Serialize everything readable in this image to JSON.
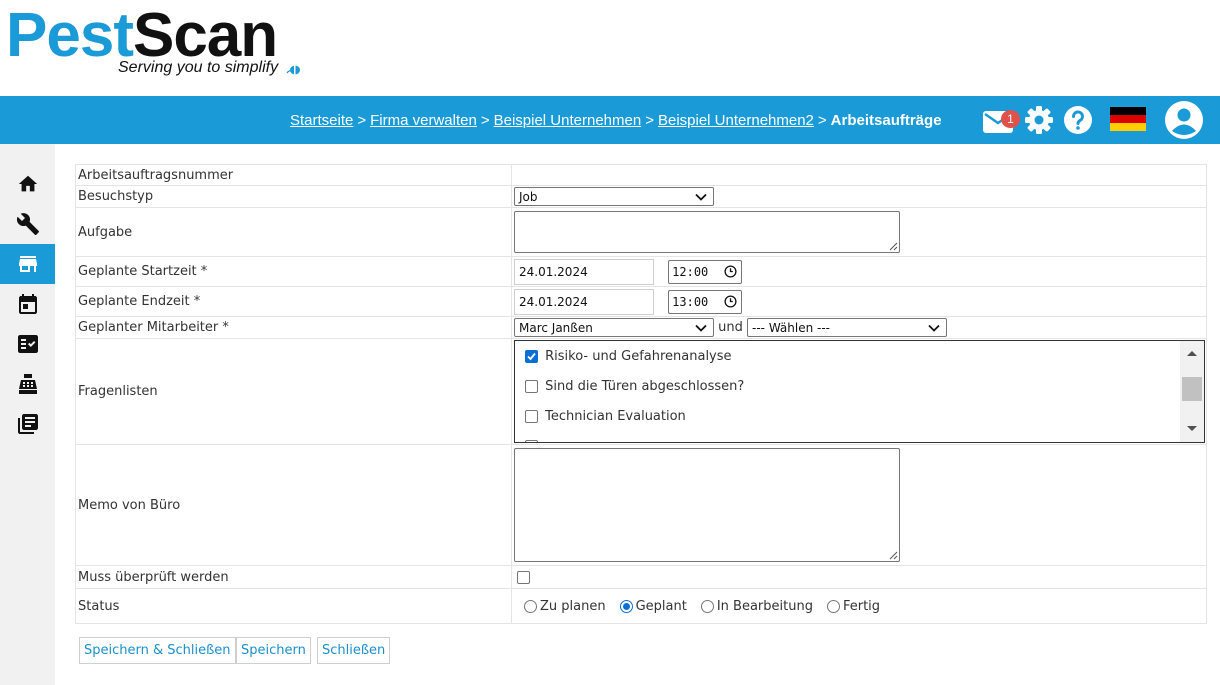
{
  "logo": {
    "part1": "Pest",
    "part2": "Scan",
    "tagline": "Serving you to simplify"
  },
  "colors": {
    "brand": "#1a9ad6",
    "badge": "#e0514a",
    "checkbox_accent": "#0b6fd6",
    "link": "#1a8fca"
  },
  "breadcrumb": {
    "items": [
      "Startseite",
      "Firma verwalten",
      "Beispiel Unternehmen",
      "Beispiel Unternehmen2"
    ],
    "current": "Arbeitsaufträge",
    "separator": ">"
  },
  "header": {
    "mail_icon": "envelope-icon",
    "mail_badge": "1",
    "settings_icon": "gear-icon",
    "help_icon": "question-circle-icon",
    "language_icon": "germany-flag-icon",
    "account_icon": "user-avatar-icon"
  },
  "sidebar": {
    "items": [
      {
        "icon": "home-icon"
      },
      {
        "icon": "wrench-icon"
      },
      {
        "icon": "store-icon",
        "active": true
      },
      {
        "icon": "calendar-icon"
      },
      {
        "icon": "checklist-icon"
      },
      {
        "icon": "cash-register-icon"
      },
      {
        "icon": "library-books-icon"
      }
    ]
  },
  "form": {
    "work_order_number": {
      "label": "Arbeitsauftragsnummer",
      "value": ""
    },
    "visit_type": {
      "label": "Besuchstyp",
      "value": "Job"
    },
    "task": {
      "label": "Aufgabe",
      "value": ""
    },
    "planned_start": {
      "label": "Geplante Startzeit *",
      "date": "24.01.2024",
      "time": "12:00"
    },
    "planned_end": {
      "label": "Geplante Endzeit *",
      "date": "24.01.2024",
      "time": "13:00"
    },
    "planned_employee": {
      "label": "Geplanter Mitarbeiter *",
      "value": "Marc Janßen",
      "and": "und",
      "second_value": "--- Wählen ---"
    },
    "question_lists": {
      "label": "Fragenlisten",
      "items": [
        {
          "label": "Risiko- und Gefahrenanalyse",
          "checked": true
        },
        {
          "label": "Sind die Türen abgeschlossen?",
          "checked": false
        },
        {
          "label": "Technician Evaluation",
          "checked": false
        }
      ]
    },
    "office_memo": {
      "label": "Memo von Büro",
      "value": ""
    },
    "must_be_reviewed": {
      "label": "Muss überprüft werden",
      "checked": false
    },
    "status": {
      "label": "Status",
      "options": [
        {
          "label": "Zu planen",
          "selected": false
        },
        {
          "label": "Geplant",
          "selected": true
        },
        {
          "label": "In Bearbeitung",
          "selected": false
        },
        {
          "label": "Fertig",
          "selected": false
        }
      ]
    }
  },
  "buttons": {
    "save_close": "Speichern & Schließen",
    "save": "Speichern",
    "close": "Schließen"
  }
}
